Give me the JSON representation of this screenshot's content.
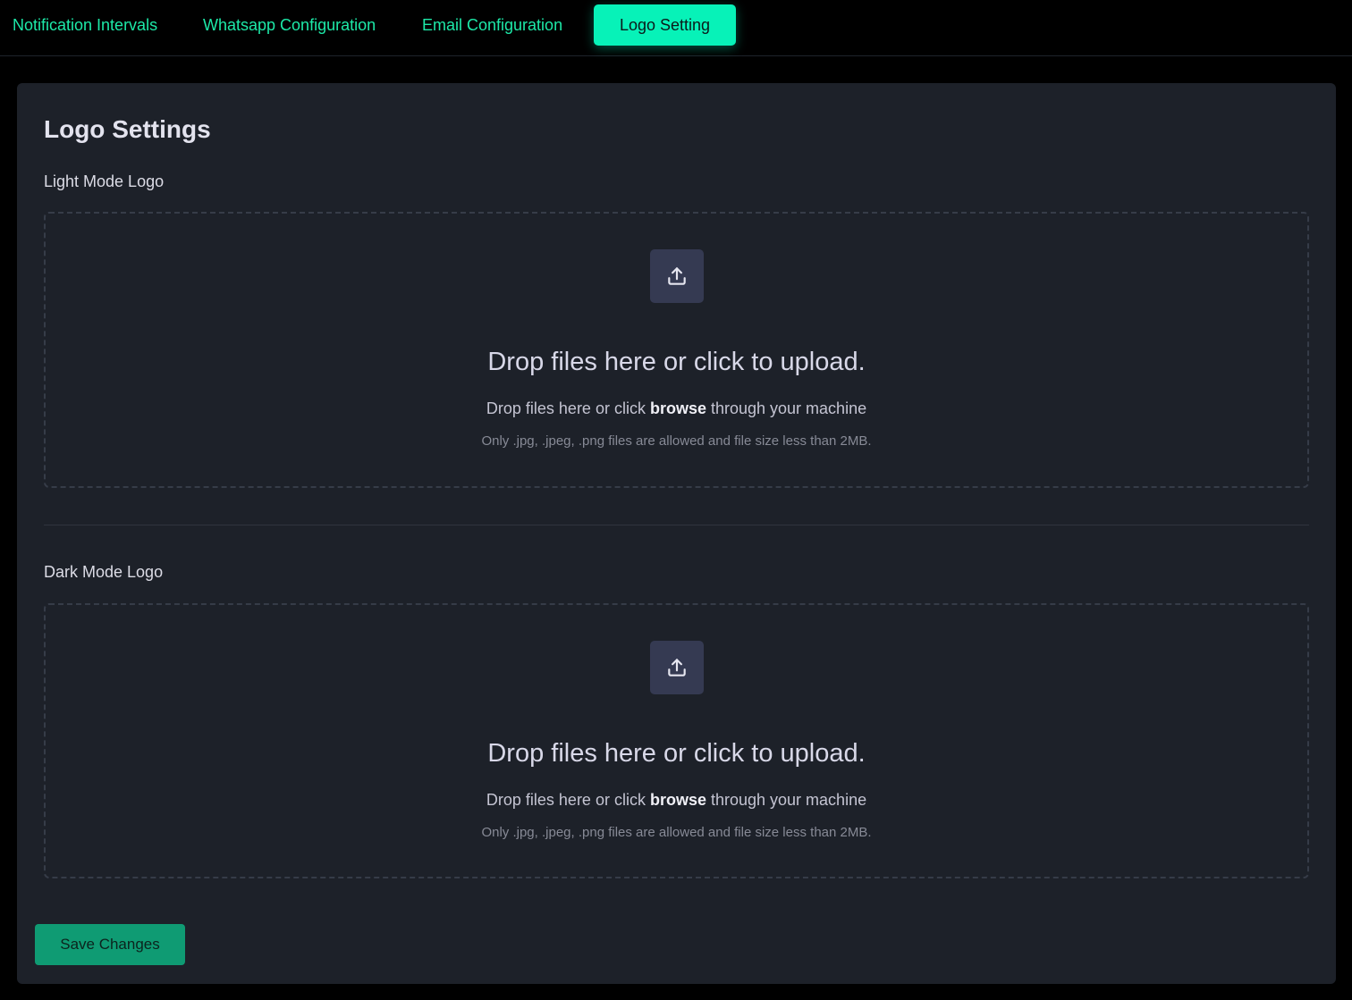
{
  "tabs": [
    {
      "label": "Notification Intervals"
    },
    {
      "label": "Whatsapp Configuration"
    },
    {
      "label": "Email Configuration"
    },
    {
      "label": "Logo Setting",
      "active": true
    }
  ],
  "page": {
    "title": "Logo Settings",
    "light_logo": {
      "label": "Light Mode Logo",
      "heading": "Drop files here or click to upload.",
      "sub_before": "Drop files here or click ",
      "sub_link": "browse",
      "sub_after": " through your machine",
      "note": "Only .jpg, .jpeg, .png files are allowed and file size less than 2MB."
    },
    "dark_logo": {
      "label": "Dark Mode Logo",
      "heading": "Drop files here or click to upload.",
      "sub_before": "Drop files here or click ",
      "sub_link": "browse",
      "sub_after": " through your machine",
      "note": "Only .jpg, .jpeg, .png files are allowed and file size less than 2MB."
    },
    "save_label": "Save Changes"
  },
  "icons": {
    "upload": "upload-icon"
  },
  "colors": {
    "accent": "#07f2b8",
    "tab_text": "#1de9a8",
    "card_bg": "#1d2129",
    "save_button": "#0f9b73",
    "icon_box": "#353a52"
  }
}
